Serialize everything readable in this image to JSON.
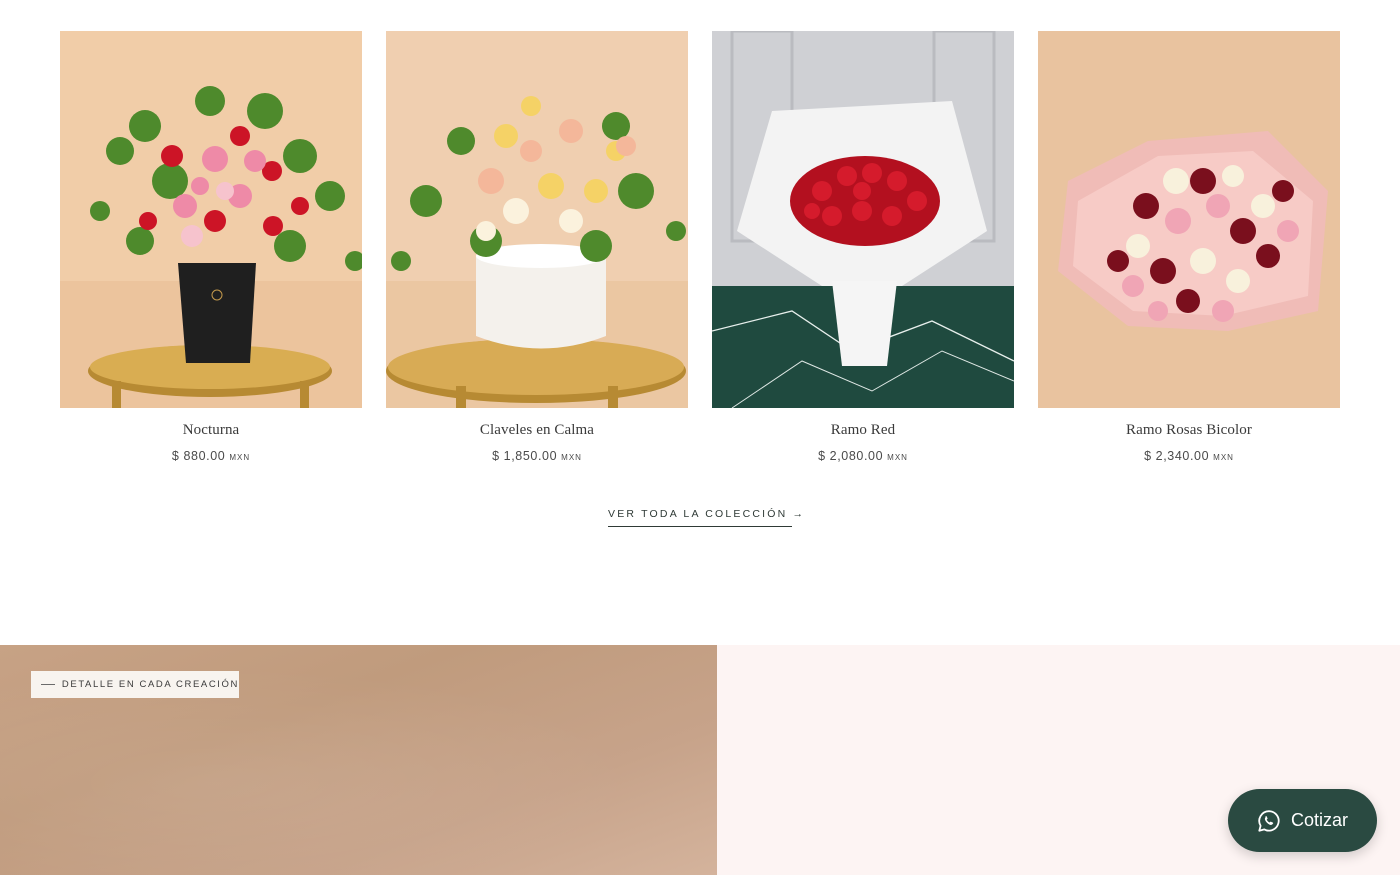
{
  "products": [
    {
      "name": "Nocturna",
      "price": "$ 880.00",
      "currency": "MXN",
      "image": "flower-arrangement-black-vase"
    },
    {
      "name": "Claveles en Calma",
      "price": "$ 1,850.00",
      "currency": "MXN",
      "image": "carnations-white-box"
    },
    {
      "name": "Ramo Red",
      "price": "$ 2,080.00",
      "currency": "MXN",
      "image": "red-roses-bouquet"
    },
    {
      "name": "Ramo Rosas Bicolor",
      "price": "$ 2,340.00",
      "currency": "MXN",
      "image": "bicolor-roses-bouquet"
    }
  ],
  "collection_link": "VER TODA LA COLECCIÓN →",
  "detail_tag": "DETALLE EN CADA CREACIÓN",
  "quote_button": {
    "label": "Cotizar",
    "icon": "whatsapp-icon"
  },
  "colors": {
    "accent": "#2a4a41",
    "band_left": "#c3a083",
    "band_right": "#fdf4f3"
  }
}
